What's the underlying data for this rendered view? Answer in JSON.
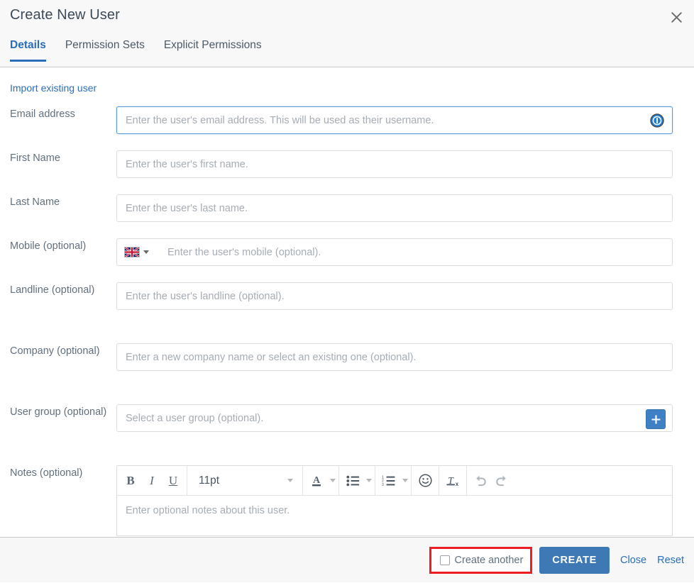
{
  "dialog": {
    "title": "Create New User",
    "close_icon": "close-icon"
  },
  "tabs": [
    {
      "label": "Details",
      "active": true
    },
    {
      "label": "Permission Sets",
      "active": false
    },
    {
      "label": "Explicit Permissions",
      "active": false
    }
  ],
  "body": {
    "import_link": "Import existing user",
    "fields": [
      {
        "label": "Email address",
        "placeholder": "Enter the user's email address. This will be used as their username.",
        "value": "",
        "focused": true,
        "info_icon": "info-icon"
      },
      {
        "label": "First Name",
        "placeholder": "Enter the user's first name.",
        "value": ""
      },
      {
        "label": "Last Name",
        "placeholder": "Enter the user's last name.",
        "value": ""
      },
      {
        "label": "Mobile (optional)",
        "placeholder": "Enter the user's mobile (optional).",
        "value": "",
        "country_flag": "united-kingdom-flag"
      },
      {
        "label": "Landline (optional)",
        "placeholder": "Enter the user's landline (optional).",
        "value": ""
      },
      {
        "label": "Company (optional)",
        "placeholder": "Enter a new company name or select an existing one (optional).",
        "value": ""
      },
      {
        "label": "User group (optional)",
        "placeholder": "Select a user group (optional).",
        "value": "",
        "add_button_icon": "plus-icon"
      },
      {
        "label": "Notes (optional)",
        "placeholder": "Enter optional notes about this user.",
        "value": ""
      }
    ],
    "editor": {
      "font_size": "11pt",
      "buttons": [
        {
          "name": "bold-button",
          "glyph": "B"
        },
        {
          "name": "italic-button",
          "glyph": "I"
        },
        {
          "name": "underline-button",
          "glyph": "U"
        },
        {
          "name": "text-color-button",
          "glyph": "A"
        },
        {
          "name": "bullet-list-button",
          "glyph": "bullet-list-icon"
        },
        {
          "name": "numbered-list-button",
          "glyph": "numbered-list-icon"
        },
        {
          "name": "emoji-button",
          "glyph": "emoji-icon"
        },
        {
          "name": "clear-format-button",
          "glyph": "clear-format-icon"
        },
        {
          "name": "undo-button",
          "glyph": "undo-icon"
        },
        {
          "name": "redo-button",
          "glyph": "redo-icon"
        }
      ]
    }
  },
  "footer": {
    "create_another_label": "Create another",
    "create_another_checked": false,
    "create_button": "CREATE",
    "close_link": "Close",
    "reset_link": "Reset",
    "highlight_color": "#ee1c25"
  },
  "colors": {
    "accent": "#2a6ebb",
    "primary_button": "#3f79b5",
    "header_bg": "#f8f8f8",
    "footer_bg": "#f7f7f7",
    "placeholder": "#a6adb4"
  }
}
